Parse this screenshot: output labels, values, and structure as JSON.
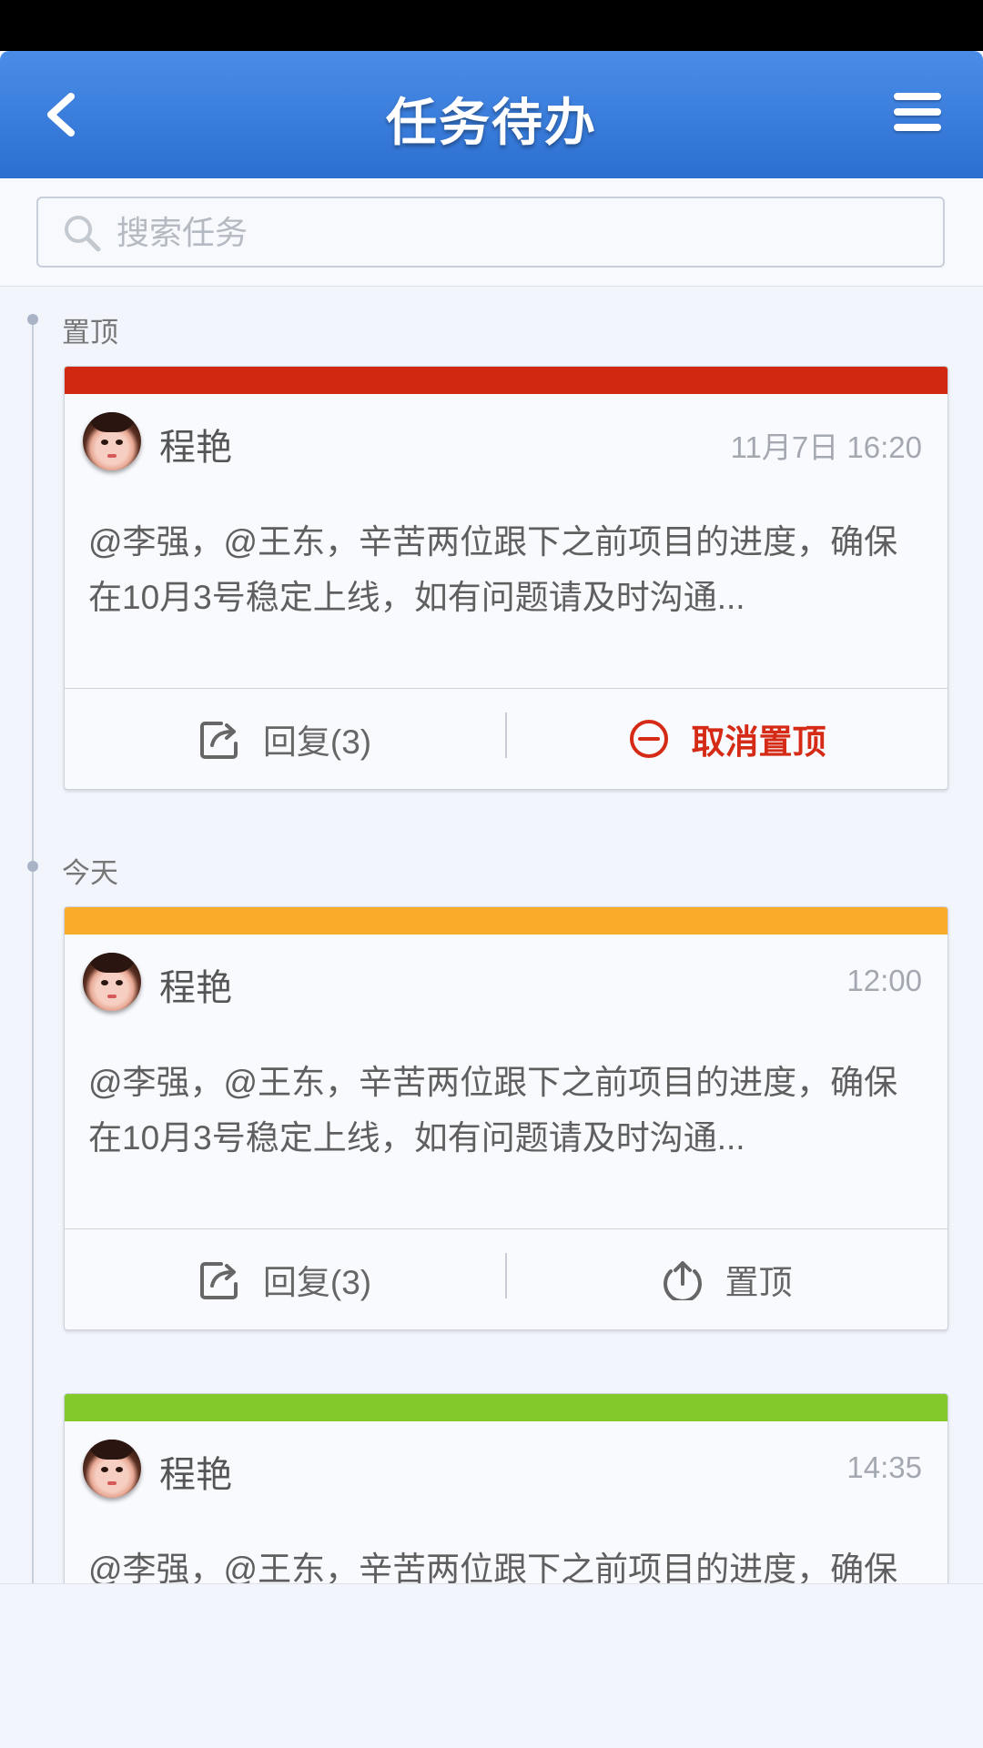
{
  "header": {
    "title": "任务待办"
  },
  "search": {
    "placeholder": "搜索任务"
  },
  "sections": [
    {
      "label": "置顶"
    },
    {
      "label": "今天"
    }
  ],
  "cards": [
    {
      "accent": "#d0290f",
      "name": "程艳",
      "time": "11月7日 16:20",
      "content": "@李强，@王东，辛苦两位跟下之前项目的进度，确保在10月3号稳定上线，如有问题请及时沟通...",
      "reply_label": "回复(3)",
      "action_label": "取消置顶",
      "action_icon": "minus-circle-icon"
    },
    {
      "accent": "#fbab2a",
      "name": "程艳",
      "time": "12:00",
      "content": "@李强，@王东，辛苦两位跟下之前项目的进度，确保在10月3号稳定上线，如有问题请及时沟通...",
      "reply_label": "回复(3)",
      "action_label": "置顶",
      "action_icon": "pin-top-icon"
    },
    {
      "accent": "#84c92a",
      "name": "程艳",
      "time": "14:35",
      "content": "@李强，@王东，辛苦两位跟下之前项目的进度，确保"
    }
  ]
}
